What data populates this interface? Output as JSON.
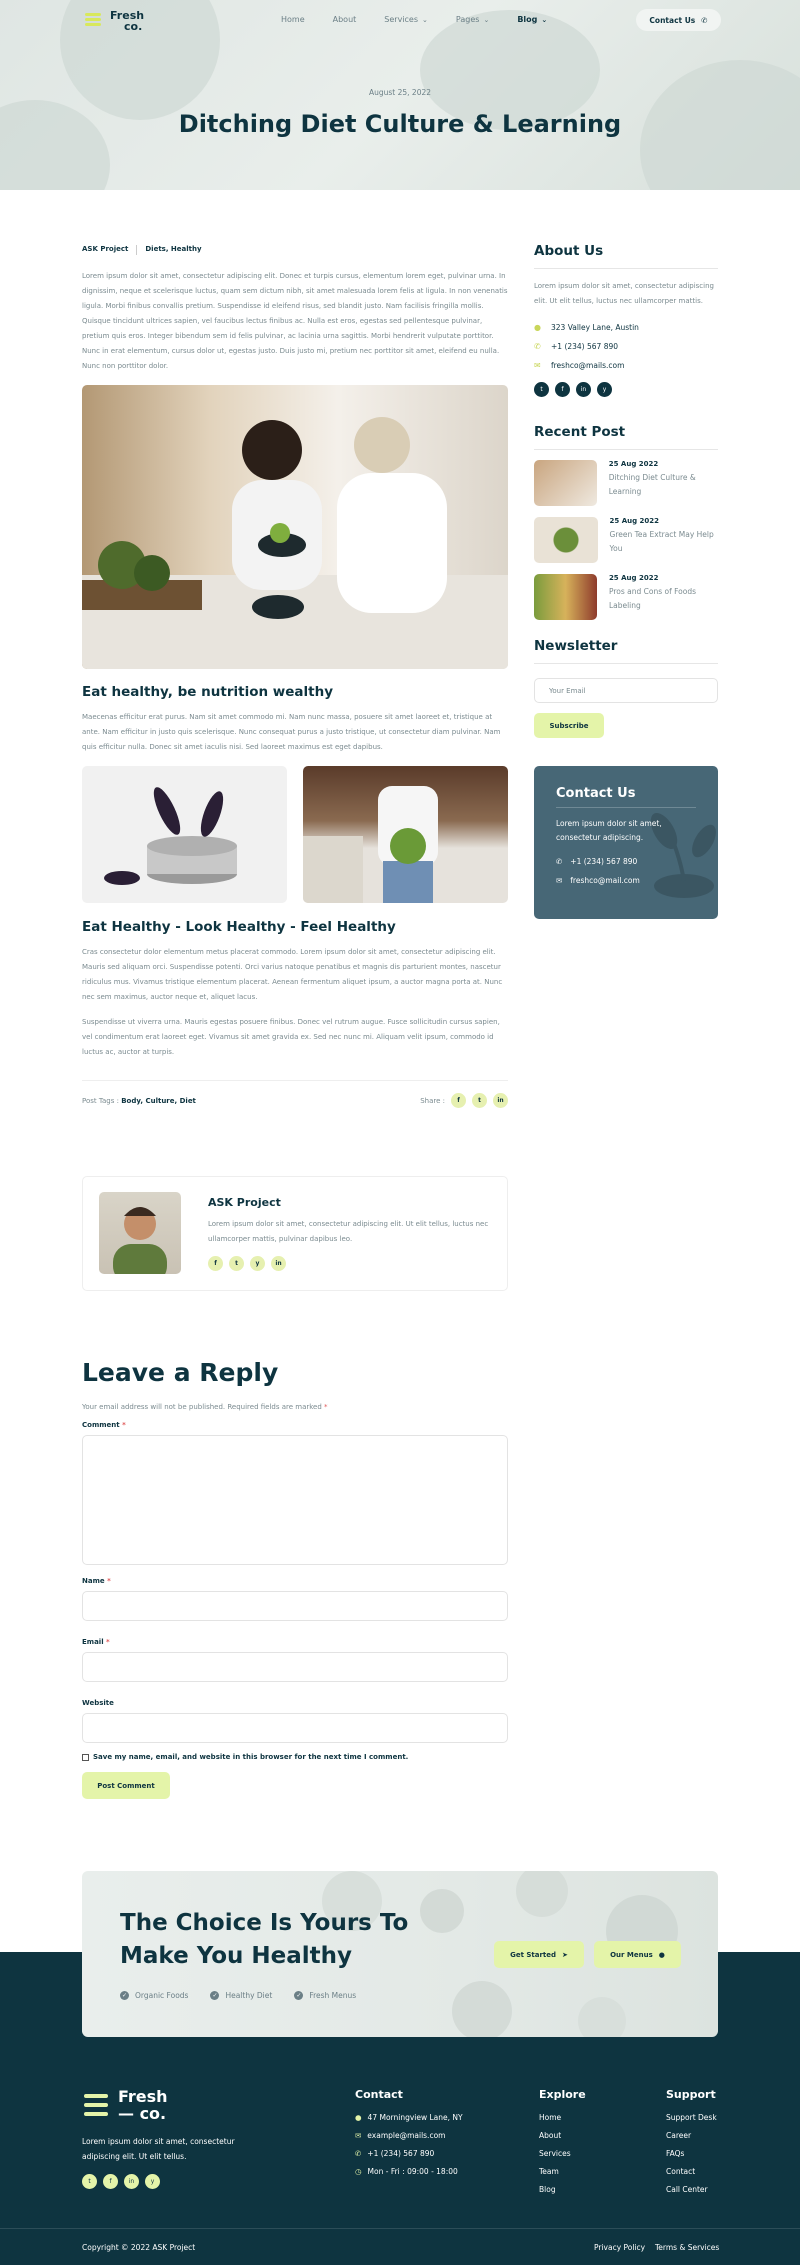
{
  "nav": {
    "logo_line1": "Fresh",
    "logo_line2": "co.",
    "items": [
      {
        "label": "Home"
      },
      {
        "label": "About"
      },
      {
        "label": "Services"
      },
      {
        "label": "Pages"
      },
      {
        "label": "Blog"
      }
    ],
    "contact_label": "Contact Us"
  },
  "hero": {
    "date": "August 25, 2022",
    "title": "Ditching Diet Culture & Learning"
  },
  "post": {
    "author": "ASK Project",
    "categories": "Diets, Healthy",
    "intro": "Lorem ipsum dolor sit amet, consectetur adipiscing elit. Donec et turpis cursus, elementum lorem eget, pulvinar urna. In dignissim, neque et scelerisque luctus, quam sem dictum nibh, sit amet malesuada lorem felis at ligula. In non venenatis ligula. Morbi finibus convallis pretium. Suspendisse id eleifend risus, sed blandit justo. Nam facilisis fringilla mollis. Quisque tincidunt ultrices sapien, vel faucibus lectus finibus ac. Nulla est eros, egestas sed pellentesque pulvinar, pretium quis eros. Integer bibendum sem id felis pulvinar, ac lacinia urna sagittis. Morbi hendrerit vulputate porttitor. Nunc in erat elementum, cursus dolor ut, egestas justo. Duis justo mi, pretium nec porttitor sit amet, eleifend eu nulla. Nunc non porttitor dolor.",
    "heading1": "Eat healthy, be nutrition wealthy",
    "para1": "Maecenas efficitur erat purus. Nam sit amet commodo mi. Nam nunc massa, posuere sit amet laoreet et, tristique at ante. Nam efficitur in justo quis scelerisque. Nunc consequat purus a justo tristique, ut consectetur diam pulvinar. Nam quis efficitur nulla. Donec sit amet iaculis nisi. Sed laoreet maximus est eget dapibus.",
    "heading2": "Eat Healthy - Look Healthy - Feel Healthy",
    "para2": "Cras consectetur dolor elementum metus placerat commodo. Lorem ipsum dolor sit amet, consectetur adipiscing elit. Mauris sed aliquam orci. Suspendisse potenti. Orci varius natoque penatibus et magnis dis parturient montes, nascetur ridiculus mus. Vivamus tristique elementum placerat. Aenean fermentum aliquet ipsum, a auctor magna porta at. Nunc nec sem maximus, auctor neque et, aliquet lacus.",
    "para3": "Suspendisse ut viverra urna. Mauris egestas posuere finibus. Donec vel rutrum augue. Fusce sollicitudin cursus sapien, vel condimentum erat laoreet eget. Vivamus sit amet gravida ex. Sed nec nunc mi. Aliquam velit ipsum, commodo id luctus ac, auctor at turpis.",
    "tags_label": "Post Tags :",
    "tags": "Body, Culture, Diet",
    "share_label": "Share :",
    "share_icons": [
      "f",
      "t",
      "in"
    ]
  },
  "author_box": {
    "name": "ASK Project",
    "bio": "Lorem ipsum dolor sit amet, consectetur adipiscing elit. Ut elit tellus, luctus nec ullamcorper mattis, pulvinar dapibus leo.",
    "icons": [
      "f",
      "t",
      "y",
      "in"
    ]
  },
  "reply": {
    "title": "Leave a Reply",
    "note": "Your email address will not be published. Required fields are marked",
    "note_star": "*",
    "comment_label": "Comment",
    "name_label": "Name",
    "email_label": "Email",
    "website_label": "Website",
    "required": "*",
    "save_label": "Save my name, email, and website in this browser for the next time I comment.",
    "submit_label": "Post Comment"
  },
  "sidebar": {
    "about_title": "About Us",
    "about_text": "Lorem ipsum dolor sit amet, consectetur adipiscing elit. Ut elit tellus, luctus nec ullamcorper mattis.",
    "address": "323 Valley Lane, Austin",
    "phone": "+1 (234) 567 890",
    "email": "freshco@mails.com",
    "social": [
      "t",
      "f",
      "in",
      "y"
    ],
    "recent_title": "Recent Post",
    "recent": [
      {
        "date": "25 Aug 2022",
        "title": "Ditching Diet Culture & Learning"
      },
      {
        "date": "25 Aug 2022",
        "title": "Green Tea Extract May Help You"
      },
      {
        "date": "25 Aug 2022",
        "title": "Pros and Cons of Foods Labeling"
      }
    ],
    "newsletter_title": "Newsletter",
    "newsletter_placeholder": "Your Email",
    "subscribe_label": "Subscribe",
    "card_title": "Contact Us",
    "card_text": "Lorem ipsum dolor sit amet, consectetur adipiscing.",
    "card_phone": "+1 (234) 567 890",
    "card_email": "freshco@mail.com"
  },
  "cta": {
    "title_line1": "The Choice Is Yours To",
    "title_line2": "Make You Healthy",
    "checks": [
      "Organic Foods",
      "Healthy Diet",
      "Fresh Menus"
    ],
    "btn1": "Get Started",
    "btn2": "Our Menus"
  },
  "footer": {
    "logo_line1": "Fresh",
    "logo_line2": "— co.",
    "about": "Lorem ipsum dolor sit amet, consectetur adipiscing elit. Ut elit tellus.",
    "social": [
      "t",
      "f",
      "in",
      "y"
    ],
    "contact_title": "Contact",
    "contact": [
      "47 Morningview Lane, NY",
      "example@mails.com",
      "+1 (234) 567 890",
      "Mon - Fri : 09:00 - 18:00"
    ],
    "explore_title": "Explore",
    "explore": [
      "Home",
      "About",
      "Services",
      "Team",
      "Blog"
    ],
    "support_title": "Support",
    "support": [
      "Support Desk",
      "Career",
      "FAQs",
      "Contact",
      "Call Center"
    ],
    "copyright": "Copyright © 2022 ASK Project",
    "privacy": "Privacy Policy",
    "terms": "Terms & Services"
  },
  "colors": {
    "primary": "#0e3440",
    "accent": "#e4f4a9",
    "card": "#476776"
  }
}
